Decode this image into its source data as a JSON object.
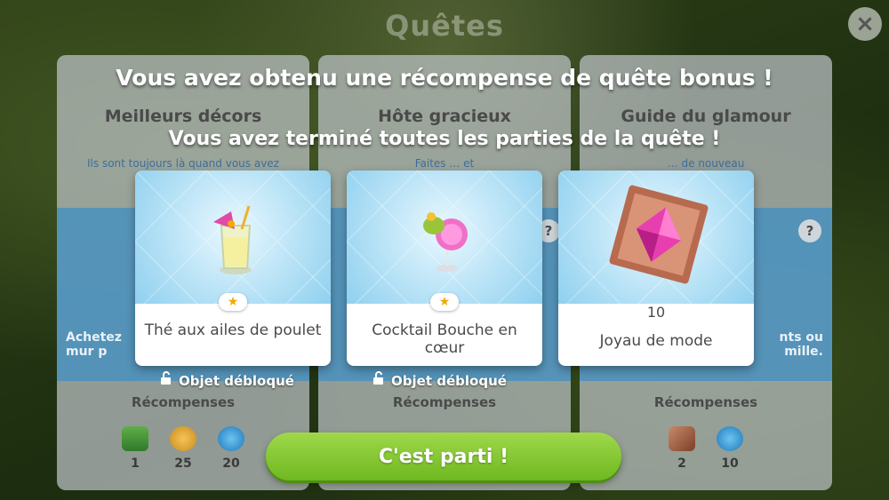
{
  "screen": {
    "title": "Quêtes",
    "close_glyph": "×"
  },
  "headline": "Vous avez obtenu une récompense de quête bonus !",
  "subline": "Vous avez terminé toutes les parties de la quête !",
  "quests": [
    {
      "name": "Meilleurs décors",
      "description": "Ils sont toujours là quand vous avez besoin de",
      "task": "Achetez\nmur p",
      "rewards_label": "Récompenses",
      "rewards": [
        {
          "icon": "cash-bundle-icon",
          "value": "1"
        },
        {
          "icon": "simoleon-coin-icon",
          "value": "25"
        },
        {
          "icon": "xp-badge-icon",
          "value": "20"
        }
      ]
    },
    {
      "name": "Hôte gracieux",
      "description": "Faites … et",
      "task": "",
      "rewards_label": "Récompenses",
      "rewards": []
    },
    {
      "name": "Guide du glamour",
      "description": "… de nouveau",
      "task": "nts ou\nmille.",
      "rewards_label": "Récompenses",
      "rewards": [
        {
          "icon": "fashion-gem-icon",
          "value": "2"
        },
        {
          "icon": "xp-badge-icon",
          "value": "10"
        }
      ]
    }
  ],
  "reward_cards": [
    {
      "name": "Thé aux ailes de poulet",
      "icon": "iced-tea-glass-icon",
      "rarity": "★",
      "unlock_label": "Objet débloqué"
    },
    {
      "name": "Cocktail Bouche en cœur",
      "icon": "pink-cocktail-icon",
      "rarity": "★",
      "unlock_label": "Objet débloqué"
    },
    {
      "name": "Joyau de mode",
      "icon": "fashion-gem-icon",
      "amount": "10"
    }
  ],
  "help_glyph": "?",
  "cta_label": "C'est parti !",
  "colors": {
    "cta": "#7cc52c",
    "panel_band": "#3f8fc4",
    "card_art": "#b7e2f6"
  }
}
